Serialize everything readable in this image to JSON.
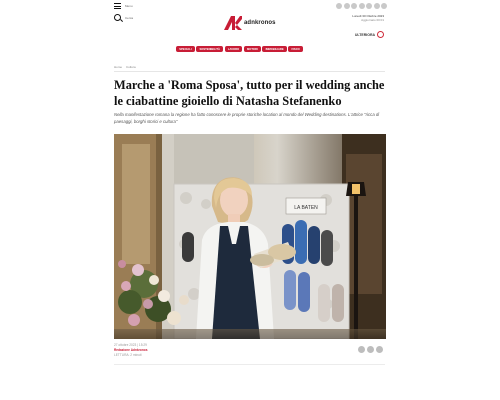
{
  "header": {
    "menu_label": "Menu",
    "search_label": "Cerca",
    "logo_text": "adnkronos",
    "date_line_1": "Lunedì 30 Ottobre 2023",
    "date_line_2": "Aggiornato 00:01",
    "partner_label": "ULTERIORA",
    "brand_color": "#c81d36"
  },
  "nav": {
    "items": [
      "Speciali",
      "Sostenibilità",
      "Lavoro",
      "Motori",
      "Immobiliare",
      "Fisco"
    ]
  },
  "breadcrumb": [
    "Home",
    "Cultura"
  ],
  "article": {
    "title": "Marche a 'Roma Sposa', tutto per il wedding anche le ciabattine gioiello di Natasha Stefanenko",
    "subtitle": "Nella manifestazione romana la regione ha fatto conoscere le proprie storiche location al mondo del Wedding destinations. L'attrice \"ricca di paesaggi, borghi storici e cultura\"",
    "photo_sign_text": "LA BATEN",
    "published": "27 ottobre 2023 | 15:29",
    "author": "Redazione Adnkronos",
    "reading_time": "LETTURA: 2 minuti"
  }
}
